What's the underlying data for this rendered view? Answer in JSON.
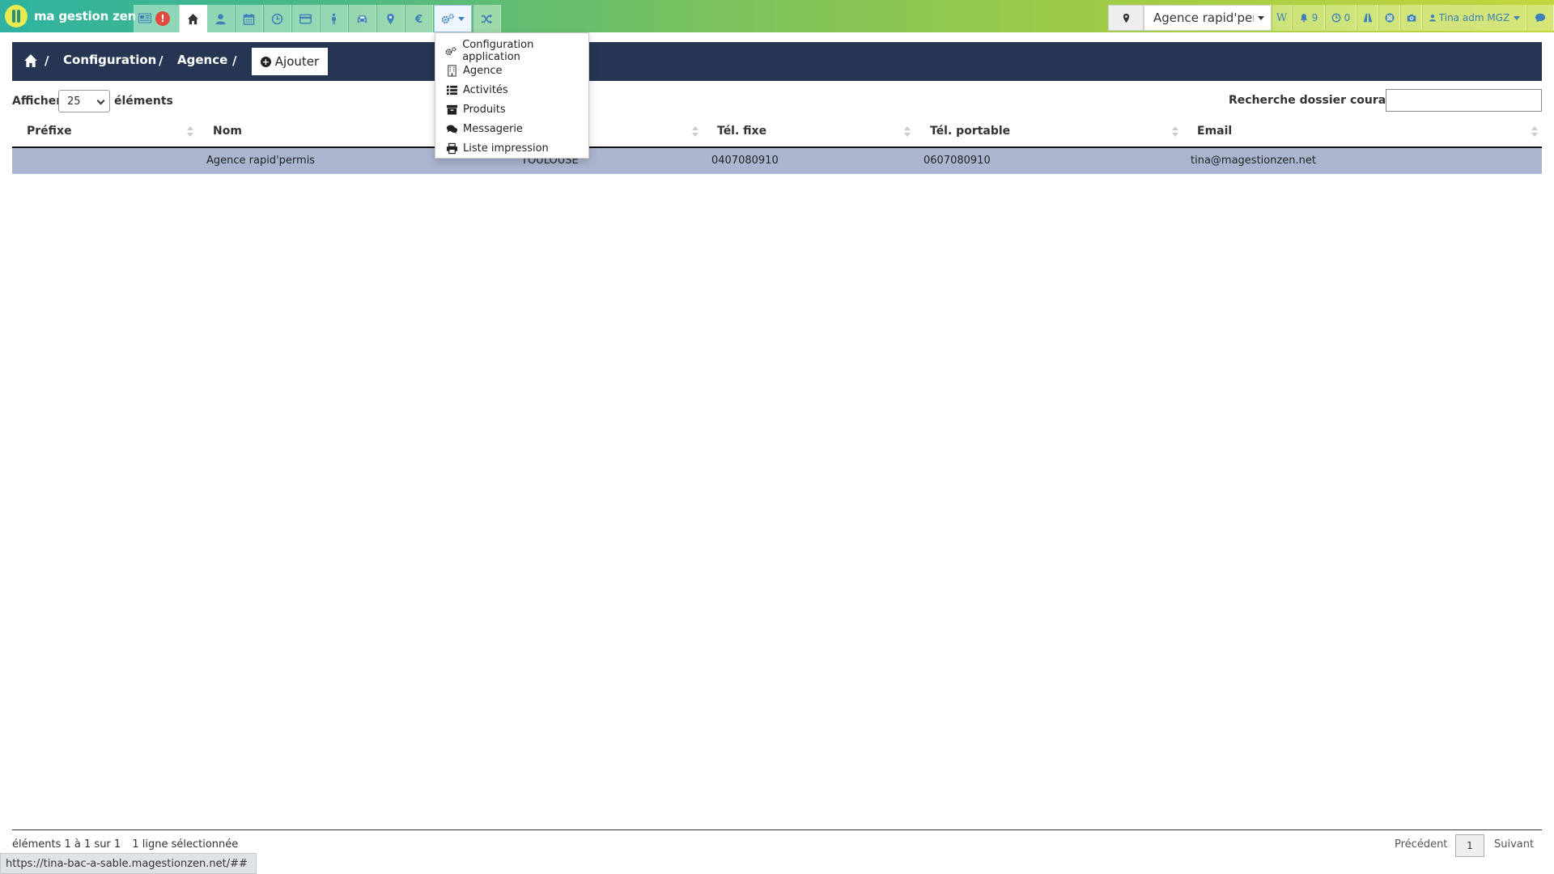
{
  "app": {
    "name": "ma gestion zen"
  },
  "topbar": {
    "alert_count": "!",
    "agency_selected": "Agence rapid'permis",
    "notifications": "9",
    "pending": "0",
    "user_name": "Tina adm MGZ",
    "accent": "#3d7fb8"
  },
  "breadcrumb": {
    "items": [
      "Configuration",
      "Agence"
    ],
    "separator": "/",
    "add_label": "Ajouter"
  },
  "table_controls": {
    "show_label": "Afficher",
    "length_value": "25",
    "elements_label": "éléments",
    "search_label": "Recherche dossier courant :",
    "search_value": ""
  },
  "table": {
    "headers": [
      "Préfixe",
      "Nom",
      "Tél. fixe",
      "Tél. portable",
      "Email"
    ],
    "rows": [
      {
        "prefixe": "",
        "nom": "Agence rapid'permis",
        "ville": "TOULOUSE",
        "tel_fixe": "0407080910",
        "tel_portable": "0607080910",
        "email": "tina@magestionzen.net"
      }
    ],
    "selected_row_color": "#aab6d0"
  },
  "dropdown": {
    "items": [
      {
        "label": "Configuration application",
        "icon": "gears-icon"
      },
      {
        "label": "Agence",
        "icon": "building-icon"
      },
      {
        "label": "Activités",
        "icon": "list-icon"
      },
      {
        "label": "Produits",
        "icon": "archive-icon"
      },
      {
        "label": "Messagerie",
        "icon": "comments-icon"
      },
      {
        "label": "Liste impression",
        "icon": "print-icon"
      }
    ]
  },
  "footer": {
    "info": "éléments 1 à 1 sur 1",
    "selection": "1 ligne sélectionnée",
    "prev_label": "Précédent",
    "current_page": "1",
    "next_label": "Suivant"
  },
  "statusbar": {
    "url": "https://tina-bac-a-sable.magestionzen.net/##"
  }
}
